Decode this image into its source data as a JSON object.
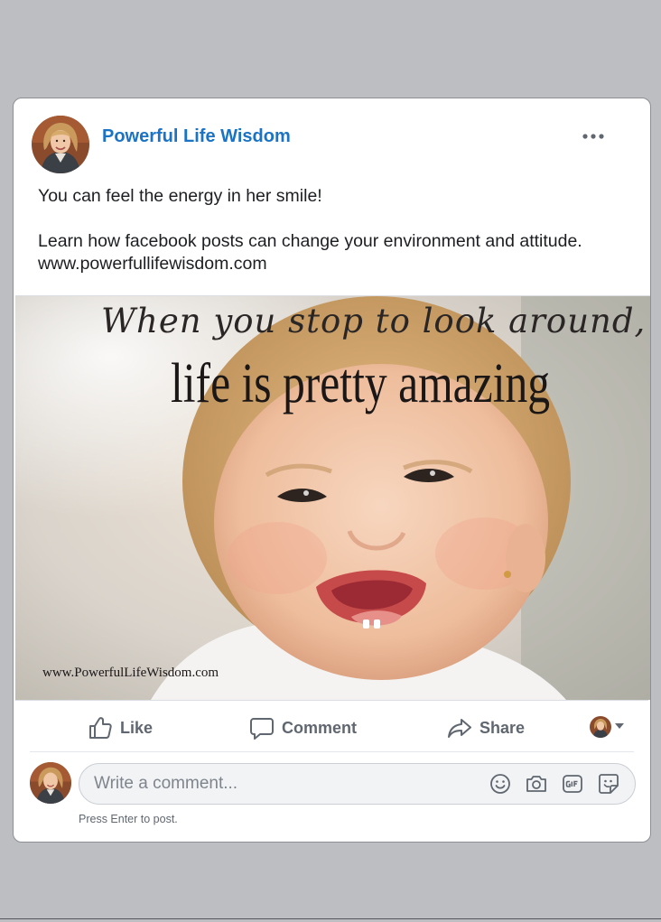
{
  "post": {
    "author": "Powerful Life Wisdom",
    "text_line1": "You can feel the energy in her smile!",
    "text_line2": "Learn how facebook posts can change your environment and attitude.",
    "text_line3": "www.powerfullifewisdom.com",
    "more_icon": "more-horizontal-icon"
  },
  "image": {
    "caption_line1": "When you stop to look around,",
    "caption_line2": "life is pretty amazing",
    "watermark": "www.PowerfulLifeWisdom.com"
  },
  "actions": {
    "like": "Like",
    "comment": "Comment",
    "share": "Share"
  },
  "comment": {
    "placeholder": "Write a comment...",
    "hint": "Press Enter to post.",
    "icons": [
      "emoji-icon",
      "camera-icon",
      "gif-icon",
      "sticker-icon"
    ]
  },
  "colors": {
    "background": "#bdbec2",
    "link": "#1a73c4",
    "action_text": "#606770"
  }
}
